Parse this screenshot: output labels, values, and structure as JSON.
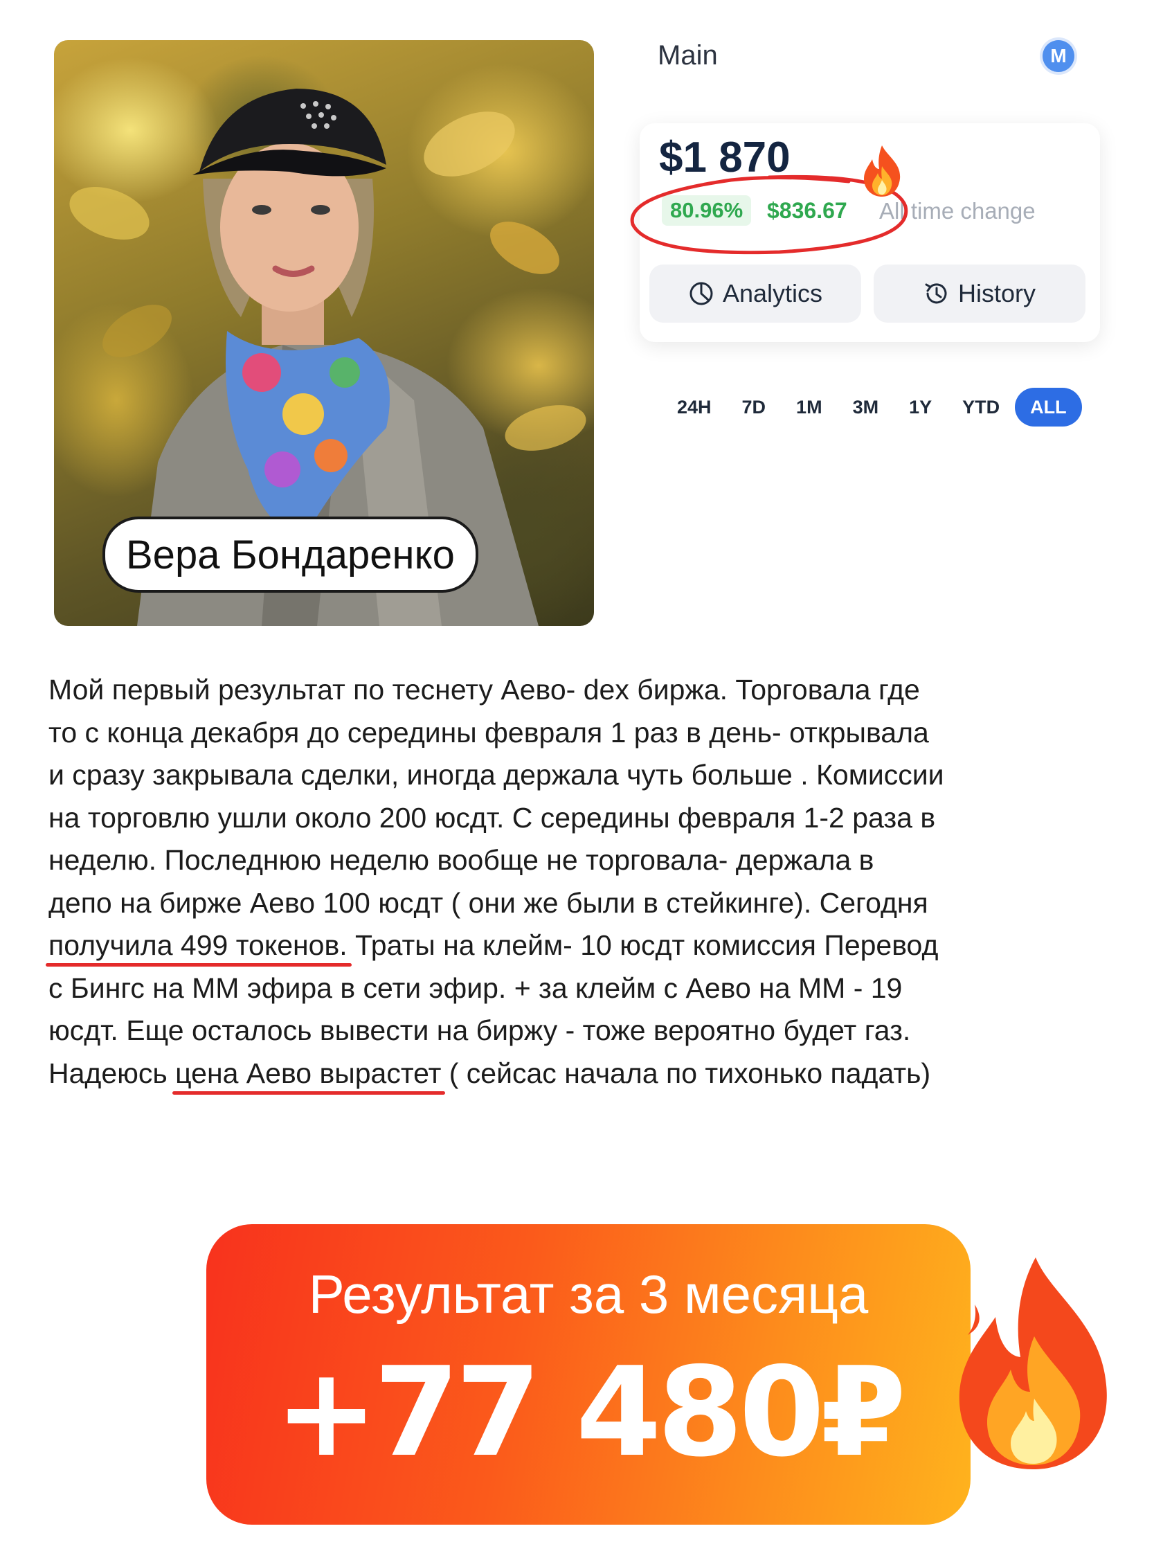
{
  "person": {
    "name": "Вера Бондаренко"
  },
  "wallet": {
    "title": "Main",
    "avatar_letter": "M",
    "balance": "$1 870",
    "change_percent": "80.96%",
    "change_value": "$836.67",
    "change_label": "All time change",
    "buttons": {
      "analytics": "Analytics",
      "history": "History"
    },
    "ranges": [
      "24H",
      "7D",
      "1M",
      "3M",
      "1Y",
      "YTD",
      "ALL"
    ],
    "active_range": "ALL",
    "colors": {
      "positive": "#2fa84f",
      "accent": "#2d6de4",
      "highlight": "#e42b2b"
    }
  },
  "story": {
    "lines": [
      "Мой первый результат по теснету Аево- dex биржа. Торговала где",
      "то с конца декабря до  середины февраля 1 раз в день- открывала",
      "и сразу закрывала сделки, иногда держала чуть больше . Комиссии",
      "на торговлю ушли около 200 юсдт.  С середины февраля 1-2 раза в",
      "неделю. Последнюю неделю вообще не торговала- держала в",
      "депо на бирже Аево 100 юсдт ( они же были в стейкинге). Сегодня"
    ],
    "line7_highlight": "получила 499 токенов.",
    "line7_rest": " Траты на клейм- 10 юсдт  комиссия Перевод",
    "line8": "с Бингс на ММ эфира в сети эфир. + за клейм с Аево на ММ - 19",
    "line9": "юсдт. Еще осталось вывести на биржу - тоже вероятно будет газ.",
    "line10_start": "Надеюсь ",
    "line10_highlight": "цена Аево вырастет",
    "line10_end": " ( сейсас начала по тихонько падать)"
  },
  "result": {
    "caption": "Результат за 3 месяца",
    "value": "+77 480₽"
  },
  "icons": [
    "pie-chart-icon",
    "history-clock-icon",
    "fire-emoji-icon"
  ]
}
